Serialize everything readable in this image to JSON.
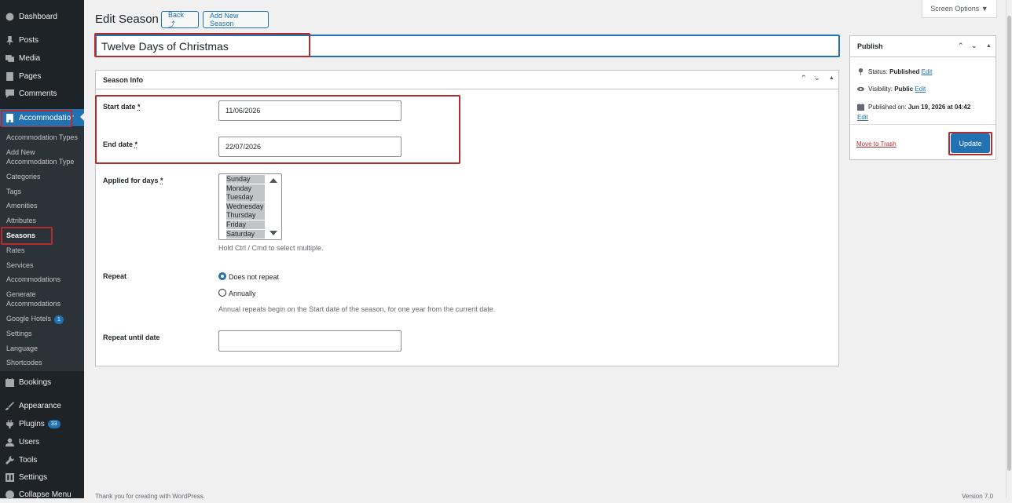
{
  "sidebar": {
    "top_items": [
      {
        "label": "Dashboard",
        "icon": "dashboard-icon"
      },
      {
        "label": "Posts",
        "icon": "pin-icon"
      },
      {
        "label": "Media",
        "icon": "media-icon"
      },
      {
        "label": "Pages",
        "icon": "pages-icon"
      },
      {
        "label": "Comments",
        "icon": "comment-icon"
      },
      {
        "label": "Accommodation",
        "icon": "building-icon"
      }
    ],
    "sub_items": [
      {
        "label": "Accommodation Types"
      },
      {
        "label": "Add New Accommodation Type"
      },
      {
        "label": "Categories"
      },
      {
        "label": "Tags"
      },
      {
        "label": "Amenities"
      },
      {
        "label": "Attributes"
      },
      {
        "label": "Seasons"
      },
      {
        "label": "Rates"
      },
      {
        "label": "Services"
      },
      {
        "label": "Accommodations"
      },
      {
        "label": "Generate Accommodations"
      },
      {
        "label": "Google Hotels",
        "badge": "1"
      },
      {
        "label": "Settings"
      },
      {
        "label": "Language"
      },
      {
        "label": "Shortcodes"
      }
    ],
    "bottom_items": [
      {
        "label": "Bookings",
        "icon": "calendar-icon"
      },
      {
        "label": "Appearance",
        "icon": "brush-icon"
      },
      {
        "label": "Plugins",
        "icon": "plugin-icon",
        "badge": "33"
      },
      {
        "label": "Users",
        "icon": "user-icon"
      },
      {
        "label": "Tools",
        "icon": "wrench-icon"
      },
      {
        "label": "Settings",
        "icon": "settings-icon"
      },
      {
        "label": "Collapse Menu",
        "icon": "collapse-icon"
      }
    ]
  },
  "header": {
    "title": "Edit Season",
    "back_label": "Back ⤴",
    "add_new_label": "Add New Season",
    "screen_options_label": "Screen Options ▼"
  },
  "title_field": {
    "value": "Twelve Days of Christmas"
  },
  "season_info": {
    "heading": "Season Info",
    "start_date": {
      "label": "Start date",
      "required": "*",
      "value": "11/06/2026"
    },
    "end_date": {
      "label": "End date",
      "required": "*",
      "value": "22/07/2026"
    },
    "applied_days": {
      "label": "Applied for days",
      "required": "*",
      "options": [
        "Sunday",
        "Monday",
        "Tuesday",
        "Wednesday",
        "Thursday",
        "Friday",
        "Saturday"
      ],
      "help": "Hold Ctrl / Cmd to select multiple."
    },
    "repeat": {
      "label": "Repeat",
      "options": [
        "Does not repeat",
        "Annually"
      ],
      "selected": "Does not repeat",
      "help": "Annual repeats begin on the Start date of the season, for one year from the current date."
    },
    "repeat_until": {
      "label": "Repeat until date",
      "value": ""
    }
  },
  "publish": {
    "heading": "Publish",
    "status_label": "Status:",
    "status_value": "Published",
    "visibility_label": "Visibility:",
    "visibility_value": "Public",
    "published_label": "Published on:",
    "published_value": "Jun 19, 2026 at 04:42",
    "edit_label": "Edit",
    "trash_label": "Move to Trash",
    "update_label": "Update"
  },
  "footer": {
    "left": "Thank you for creating with WordPress.",
    "right": "Version 7.0"
  },
  "colors": {
    "sidebar_bg": "#1d2327",
    "accent": "#2271b1",
    "highlight": "#b32d2e",
    "page_bg": "#f0f0f1"
  }
}
